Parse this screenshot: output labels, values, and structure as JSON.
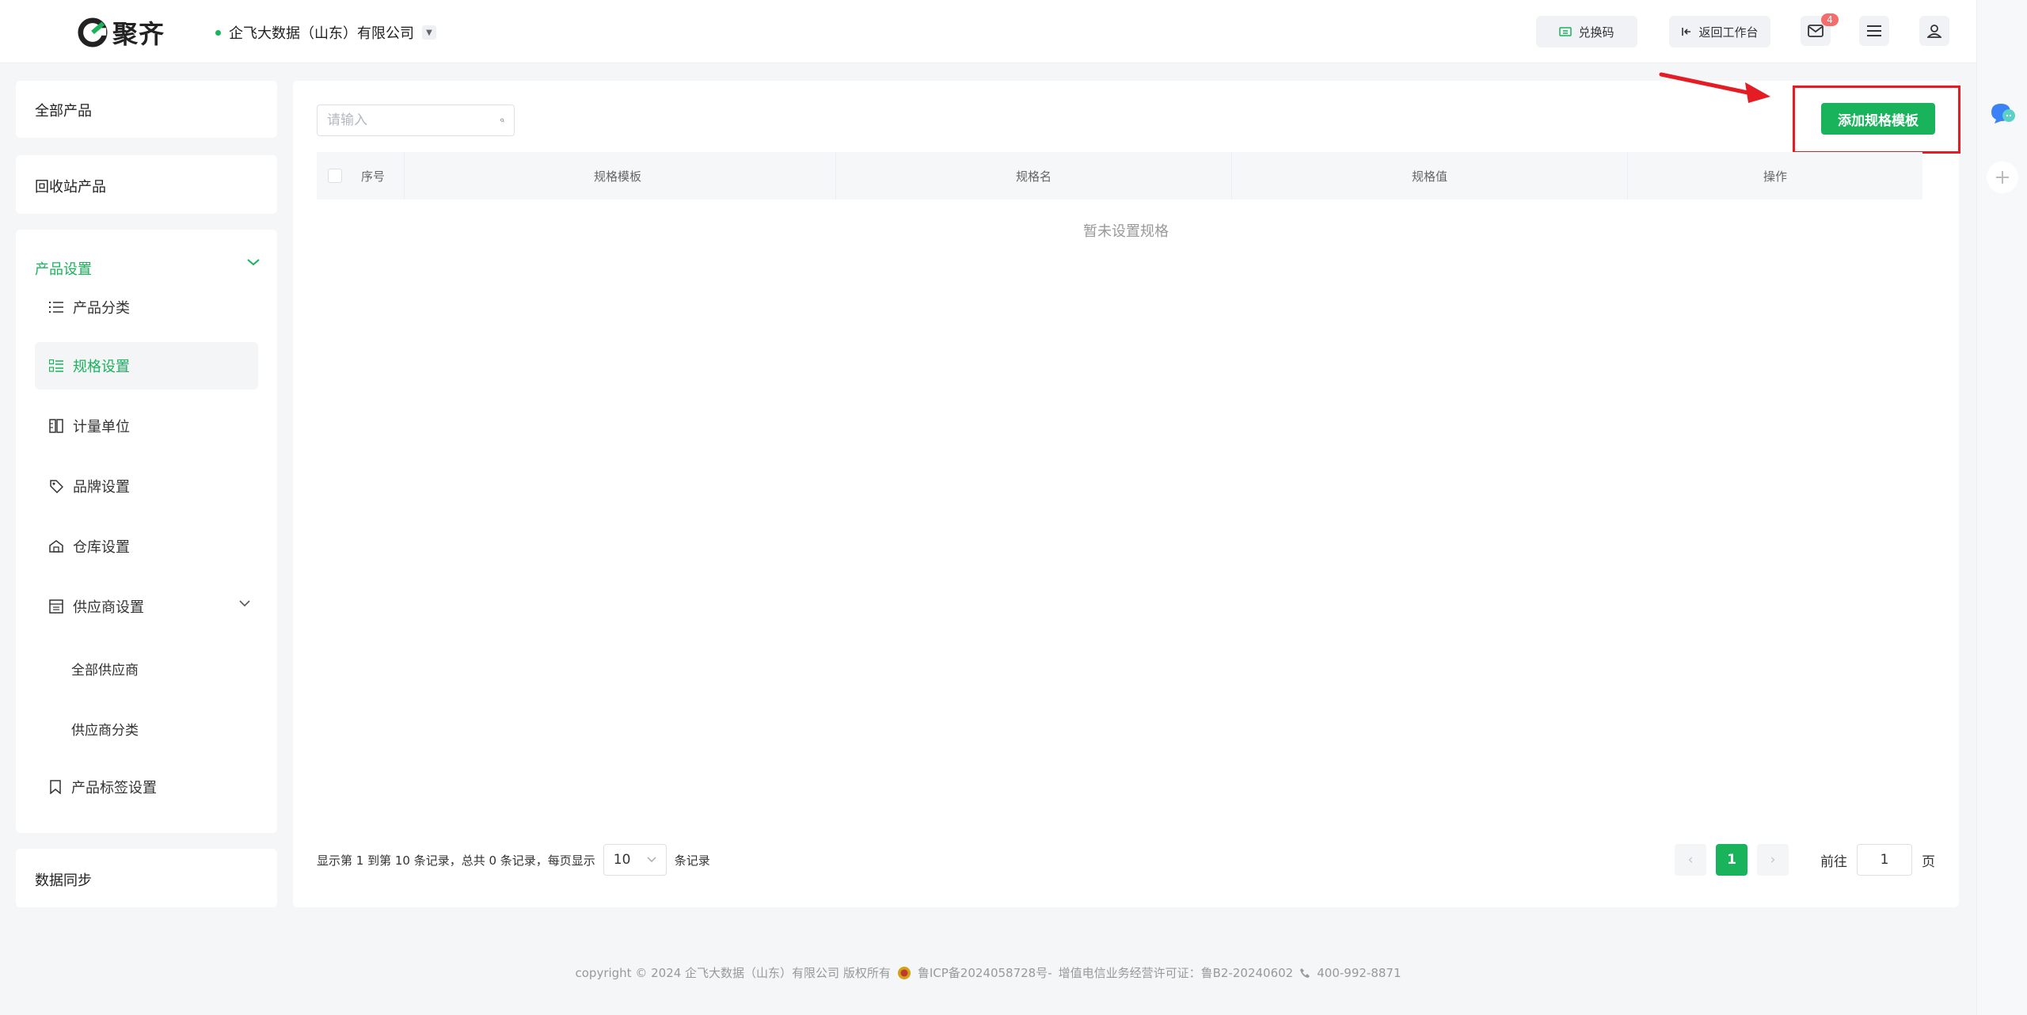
{
  "header": {
    "logo_text": "聚齐",
    "company": "企飞大数据（山东）有限公司",
    "redeem_label": "兑换码",
    "back_label": "返回工作台",
    "mail_badge": "4"
  },
  "sidebar": {
    "all_products": "全部产品",
    "recycle": "回收站产品",
    "settings_title": "产品设置",
    "items": [
      {
        "label": "产品分类"
      },
      {
        "label": "规格设置"
      },
      {
        "label": "计量单位"
      },
      {
        "label": "品牌设置"
      },
      {
        "label": "仓库设置"
      },
      {
        "label": "供应商设置"
      },
      {
        "label": "全部供应商"
      },
      {
        "label": "供应商分类"
      },
      {
        "label": "产品标签设置"
      }
    ],
    "data_sync": "数据同步"
  },
  "main": {
    "search_placeholder": "请输入",
    "add_button": "添加规格模板",
    "columns": [
      "序号",
      "规格模板",
      "规格名",
      "规格值",
      "操作"
    ],
    "empty_text": "暂未设置规格",
    "pagination": {
      "summary": "显示第 1 到第 10 条记录，总共 0 条记录，每页显示",
      "page_size": "10",
      "records_suffix": "条记录",
      "current_page": "1",
      "goto_prefix": "前往",
      "goto_value": "1",
      "goto_suffix": "页"
    }
  },
  "footer": {
    "copyright": "copyright © 2024 企飞大数据（山东）有限公司 版权所有",
    "icp": "鲁ICP备2024058728号-",
    "license": "增值电信业务经营许可证：鲁B2-20240602",
    "phone": "400-992-8871"
  },
  "colors": {
    "brand": "#18b35b",
    "highlight": "#e51c23"
  }
}
